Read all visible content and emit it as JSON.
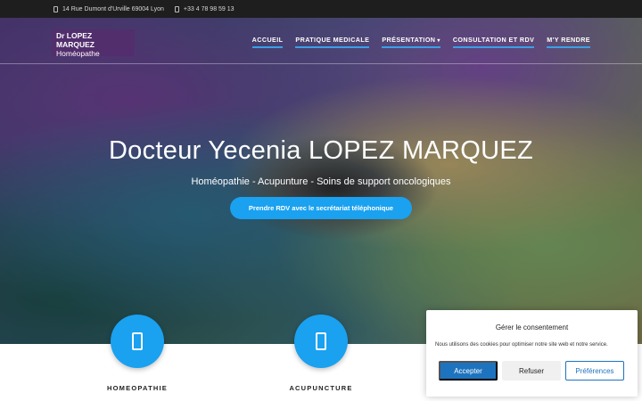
{
  "topbar": {
    "address": "14 Rue Dumont d'Urville 69004 Lyon",
    "phone": "+33 4 78 98 59 13",
    "address_icon": "map-marker-icon",
    "phone_icon": "phone-icon"
  },
  "brand": {
    "name": "Dr LOPEZ MARQUEZ",
    "subtitle": "Homéopathe"
  },
  "nav": {
    "items": [
      {
        "label": "ACCUEIL"
      },
      {
        "label": "PRATIQUE MEDICALE"
      },
      {
        "label": "PRÉSENTATION"
      },
      {
        "label": "CONSULTATION ET RDV"
      },
      {
        "label": "M'Y RENDRE"
      }
    ]
  },
  "hero": {
    "title": "Docteur Yecenia LOPEZ MARQUEZ",
    "subtitle": "Homéopathie - Acupunture - Soins de support oncologiques",
    "cta_label": "Prendre RDV avec le secrétariat téléphonique"
  },
  "services": [
    {
      "label": "HOMEOPATHIE",
      "icon": "homeopathy-icon"
    },
    {
      "label": "ACUPUNCTURE",
      "icon": "acupuncture-icon"
    }
  ],
  "consent": {
    "title": "Gérer le consentement",
    "text": "Nous utilisons des cookies pour optimiser notre site web et notre service.",
    "accept_label": "Accepter",
    "refuse_label": "Refuser",
    "preferences_label": "Préférences"
  },
  "colors": {
    "accent": "#1aa1f0",
    "topbar_bg": "#1e1e1e",
    "consent_primary": "#1e73be"
  }
}
